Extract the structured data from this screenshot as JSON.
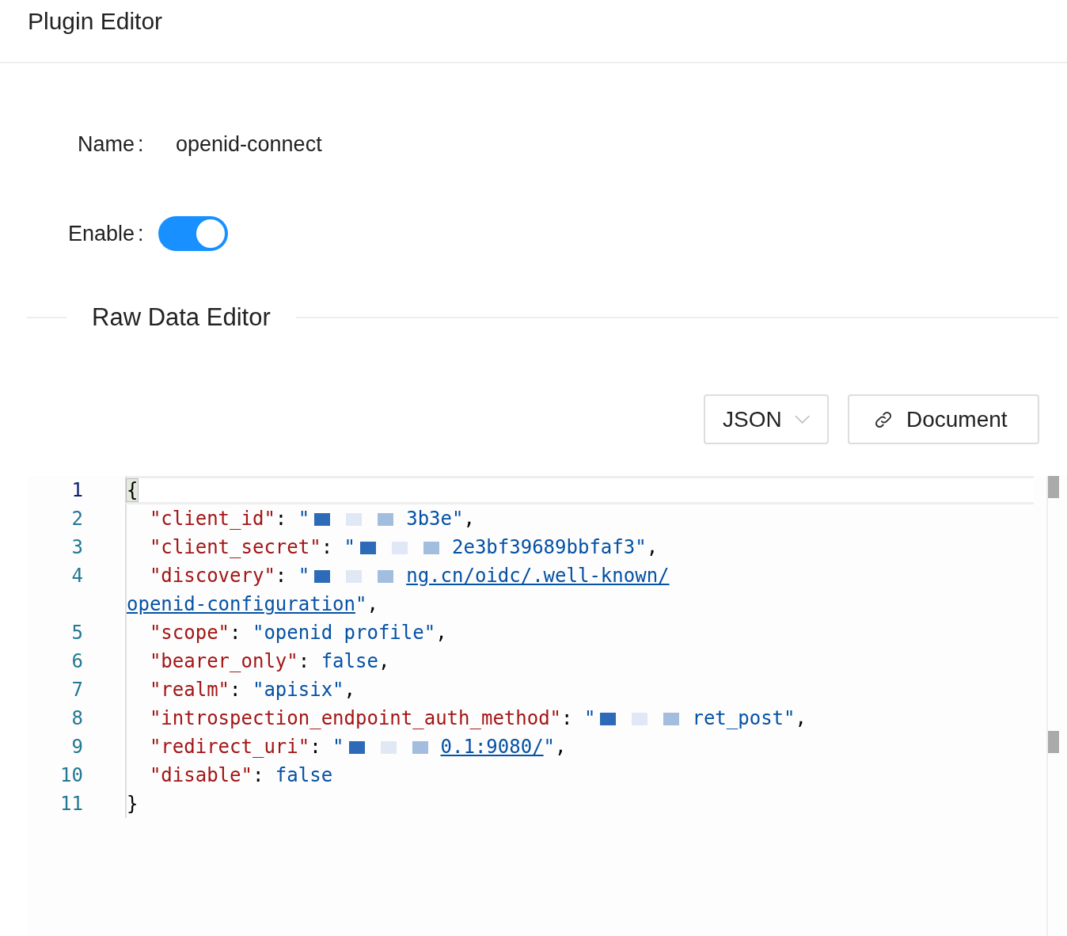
{
  "header": {
    "title": "Plugin Editor"
  },
  "form": {
    "name_label": "Name",
    "name_colon": ":",
    "enable_colon": ":",
    "name_value": "openid-connect",
    "enable_label": "Enable",
    "enabled": true
  },
  "section": {
    "title": "Raw Data Editor"
  },
  "toolbar": {
    "format": "JSON",
    "document_button": "Document"
  },
  "editor": {
    "lines": [
      {
        "number": "1",
        "active": true,
        "tokens": [
          {
            "kind": "punct",
            "text": "{"
          }
        ]
      },
      {
        "number": "2",
        "active": false,
        "tokens": [
          {
            "kind": "key",
            "text": "  \"client_id\""
          },
          {
            "kind": "punct",
            "text": ": "
          },
          {
            "kind": "string",
            "text": "\""
          },
          {
            "kind": "string",
            "redacted": true,
            "text": "3b3e\""
          },
          {
            "kind": "punct",
            "text": ","
          }
        ]
      },
      {
        "number": "3",
        "active": false,
        "tokens": [
          {
            "kind": "key",
            "text": "  \"client_secret\""
          },
          {
            "kind": "punct",
            "text": ": "
          },
          {
            "kind": "string",
            "text": "\""
          },
          {
            "kind": "string",
            "redacted": true,
            "text": "2e3bf39689bbfaf3\""
          },
          {
            "kind": "punct",
            "text": ","
          }
        ]
      },
      {
        "number": "4",
        "active": false,
        "tokens": [
          {
            "kind": "key",
            "text": "  \"discovery\""
          },
          {
            "kind": "punct",
            "text": ": "
          },
          {
            "kind": "string",
            "text": "\""
          },
          {
            "kind": "link",
            "redacted": true,
            "text": "ng.cn/oidc/.well-known/"
          }
        ]
      },
      {
        "active": false,
        "tokens": [
          {
            "kind": "link",
            "text": "openid-configuration"
          },
          {
            "kind": "string",
            "text": "\""
          },
          {
            "kind": "punct",
            "text": ","
          }
        ]
      },
      {
        "number": "5",
        "active": false,
        "tokens": [
          {
            "kind": "key",
            "text": "  \"scope\""
          },
          {
            "kind": "punct",
            "text": ": "
          },
          {
            "kind": "string",
            "text": "\"openid profile\""
          },
          {
            "kind": "punct",
            "text": ","
          }
        ]
      },
      {
        "number": "6",
        "active": false,
        "tokens": [
          {
            "kind": "key",
            "text": "  \"bearer_only\""
          },
          {
            "kind": "punct",
            "text": ": "
          },
          {
            "kind": "keyword",
            "text": "false"
          },
          {
            "kind": "punct",
            "text": ","
          }
        ]
      },
      {
        "number": "7",
        "active": false,
        "tokens": [
          {
            "kind": "key",
            "text": "  \"realm\""
          },
          {
            "kind": "punct",
            "text": ": "
          },
          {
            "kind": "string",
            "text": "\"apisix\""
          },
          {
            "kind": "punct",
            "text": ","
          }
        ]
      },
      {
        "number": "8",
        "active": false,
        "tokens": [
          {
            "kind": "key",
            "text": "  \"introspection_endpoint_auth_method\""
          },
          {
            "kind": "punct",
            "text": ": "
          },
          {
            "kind": "string",
            "text": "\""
          },
          {
            "kind": "string",
            "redacted": true,
            "text": "ret_post\""
          },
          {
            "kind": "punct",
            "text": ","
          }
        ]
      },
      {
        "number": "9",
        "active": false,
        "tokens": [
          {
            "kind": "key",
            "text": "  \"redirect_uri\""
          },
          {
            "kind": "punct",
            "text": ": "
          },
          {
            "kind": "string",
            "text": "\""
          },
          {
            "kind": "link",
            "redacted": true,
            "text": "0.1:9080/"
          },
          {
            "kind": "string",
            "text": "\""
          },
          {
            "kind": "punct",
            "text": ","
          }
        ]
      },
      {
        "number": "10",
        "active": false,
        "tokens": [
          {
            "kind": "key",
            "text": "  \"disable\""
          },
          {
            "kind": "punct",
            "text": ": "
          },
          {
            "kind": "keyword",
            "text": "false"
          }
        ]
      },
      {
        "number": "11",
        "active": false,
        "tokens": [
          {
            "kind": "punct",
            "text": "}"
          }
        ]
      }
    ]
  }
}
